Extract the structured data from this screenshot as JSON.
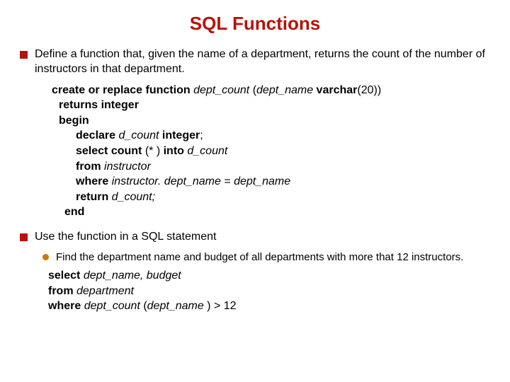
{
  "title": "SQL Functions",
  "bullet1": "Define a function that, given the name of a department, returns the count of the number of instructors in that department.",
  "code1": {
    "l1a": "create or replace ",
    "l1b": "function",
    "l1c": " dept_count ",
    "l1d": "(",
    "l1e": "dept_name ",
    "l1f": "varchar",
    "l1g": "(20))",
    "l2a": "returns integer",
    "l3a": "begin",
    "l4a": "declare",
    "l4b": " d_count ",
    "l4c": "integer",
    "l4d": ";",
    "l5a": "select count ",
    "l5b": "(* ) ",
    "l5c": "into",
    "l5d": " d_count",
    "l6a": "from",
    "l6b": " instructor",
    "l7a": "where",
    "l7b": " instructor. dept_name = dept_name",
    "l8a": "return",
    "l8b": " d_count;",
    "l9a": "end"
  },
  "bullet2": "Use the function in a SQL statement",
  "sub1": "Find the department name and budget of all departments with more that 12 instructors.",
  "code2": {
    "l1a": "select",
    "l1b": " dept_name, budget",
    "l2a": "from",
    "l2b": " department",
    "l3a": "where",
    "l3b": " dept_count ",
    "l3c": "(",
    "l3d": "dept_name ",
    "l3e": ") > 12"
  }
}
